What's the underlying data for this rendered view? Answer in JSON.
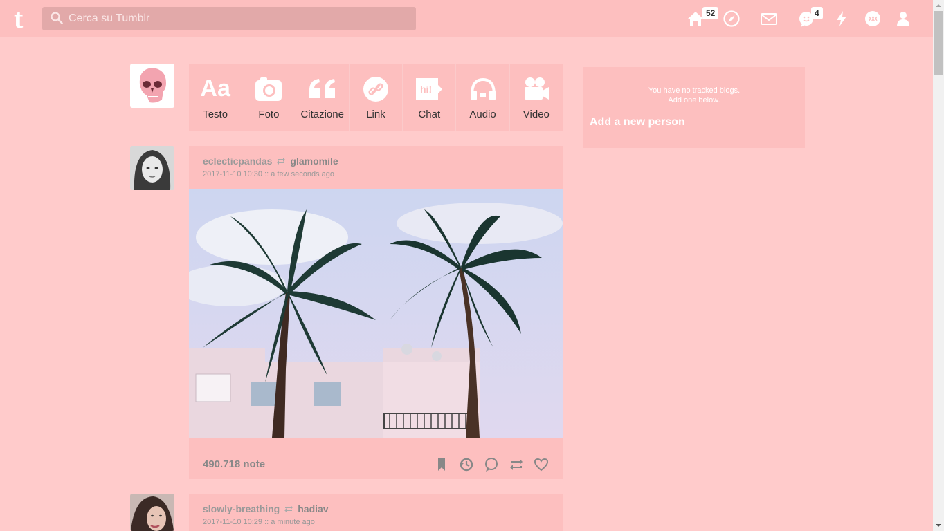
{
  "header": {
    "logo": "t",
    "search_placeholder": "Cerca su Tumblr",
    "home_badge": "52",
    "messaging_badge": "4"
  },
  "composer": {
    "items": [
      {
        "label": "Testo",
        "icon": "text-icon"
      },
      {
        "label": "Foto",
        "icon": "camera-icon"
      },
      {
        "label": "Citazione",
        "icon": "quote-icon"
      },
      {
        "label": "Link",
        "icon": "link-icon"
      },
      {
        "label": "Chat",
        "icon": "chat-icon"
      },
      {
        "label": "Audio",
        "icon": "headphones-icon"
      },
      {
        "label": "Video",
        "icon": "video-camera-icon"
      }
    ],
    "chat_icon_text": "hi!"
  },
  "posts": [
    {
      "blog": "eclecticpandas",
      "reblogged_from": "glamomile",
      "timestamp": "2017-11-10 10:30 :: a few seconds ago",
      "notes": "490.718 note"
    },
    {
      "blog": "slowly-breathing",
      "reblogged_from": "hadiav",
      "timestamp": "2017-11-10 10:29 :: a minute ago"
    }
  ],
  "sidebar": {
    "tracked_message_line1": "You have no tracked blogs.",
    "tracked_message_line2": "Add one below.",
    "add_person": "Add a new person"
  },
  "colors": {
    "background": "#ffcbcb",
    "panel": "#fdbfbf",
    "search_bg": "#e2a9a9"
  }
}
